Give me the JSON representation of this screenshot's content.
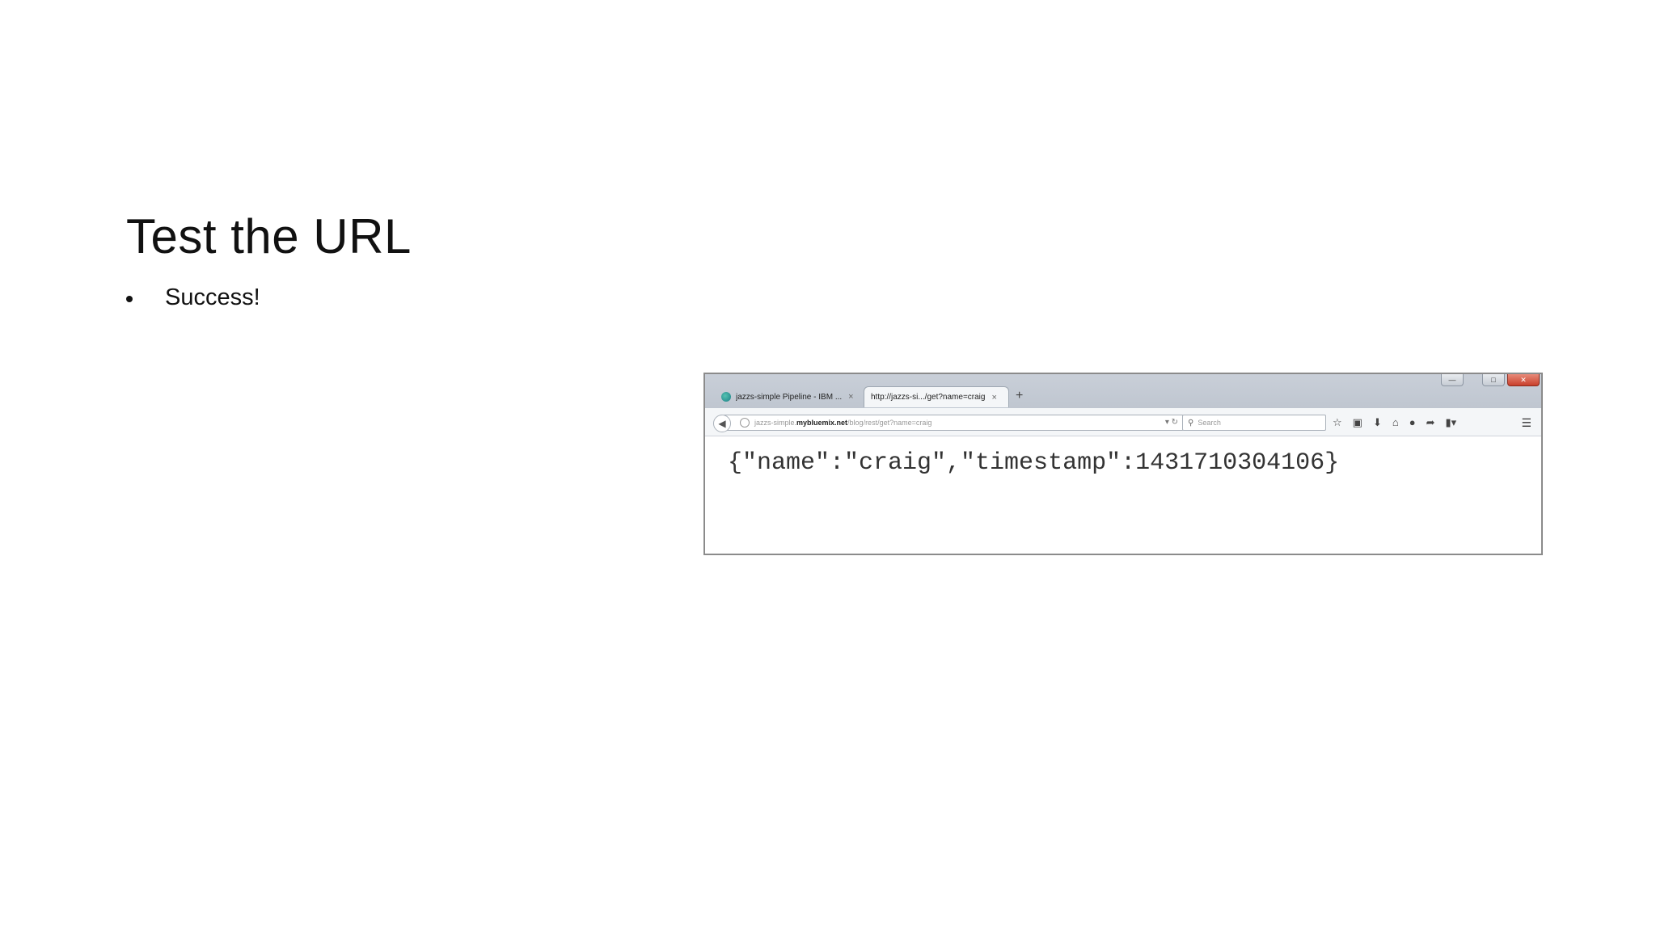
{
  "slide": {
    "title": "Test the URL",
    "bullets": [
      "Success!"
    ]
  },
  "browser": {
    "tabs": [
      {
        "label": "jazzs-simple Pipeline - IBM ...",
        "icon": "bluemix-favicon-icon",
        "active": false
      },
      {
        "label": "http://jazzs-si.../get?name=craig",
        "active": true
      }
    ],
    "new_tab_label": "+",
    "window_controls": {
      "minimize": "—",
      "maximize": "□",
      "close": "✕"
    },
    "url": {
      "prefix": "jazzs-simple.",
      "domain": "mybluemix.net",
      "path": "/blog/rest/get?name=craig"
    },
    "search_placeholder": "Search",
    "toolbar_icons": [
      "star-icon",
      "bookmarks-icon",
      "download-icon",
      "home-icon",
      "chat-icon",
      "share-icon",
      "extension-icon",
      "menu-icon"
    ],
    "page_content": "{\"name\":\"craig\",\"timestamp\":1431710304106}"
  }
}
